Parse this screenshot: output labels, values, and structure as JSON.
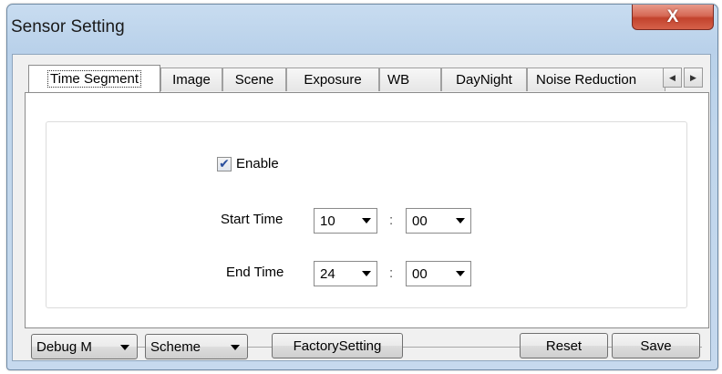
{
  "window": {
    "title": "Sensor Setting",
    "close_label": "X"
  },
  "tabs": [
    {
      "label": "Time Segment",
      "active": true
    },
    {
      "label": "Image"
    },
    {
      "label": "Scene"
    },
    {
      "label": "Exposure"
    },
    {
      "label": "WB"
    },
    {
      "label": "DayNight"
    },
    {
      "label": "Noise Reduction"
    }
  ],
  "tab_scroll": {
    "left_icon": "◀",
    "right_icon": "▶"
  },
  "time_segment": {
    "enable_label": "Enable",
    "enable_checked": true,
    "check_glyph": "✔",
    "start_time_label": "Start Time",
    "start_hour": "10",
    "start_minute": "00",
    "end_time_label": "End Time",
    "end_hour": "24",
    "end_minute": "00",
    "separator": ":"
  },
  "footer": {
    "debug_mode_label": "Debug M",
    "scheme_label": "Scheme",
    "factory_setting_label": "FactorySetting",
    "reset_label": "Reset",
    "save_label": "Save"
  },
  "colors": {
    "title_bar": "#b9d1ea",
    "close_button": "#c2432d",
    "checkmark": "#2a4f9e"
  }
}
